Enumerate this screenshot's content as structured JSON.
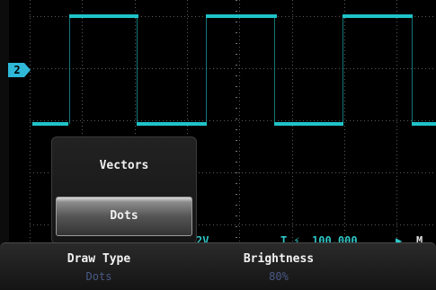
{
  "channel_marker": {
    "label": "2",
    "color": "#2fb8d8"
  },
  "trace": {
    "color": "#1fc3c8",
    "high_segments": 3,
    "low_segments": 4
  },
  "menu": {
    "options": [
      {
        "label": "Vectors",
        "selected": false
      },
      {
        "label": "Dots",
        "selected": true
      }
    ]
  },
  "status": {
    "ch_scale": "2V",
    "trigger": "100.000",
    "right": "M"
  },
  "softkeys": {
    "draw_type": {
      "label": "Draw Type",
      "value": "Dots"
    },
    "brightness": {
      "label": "Brightness",
      "value": "80%"
    }
  }
}
